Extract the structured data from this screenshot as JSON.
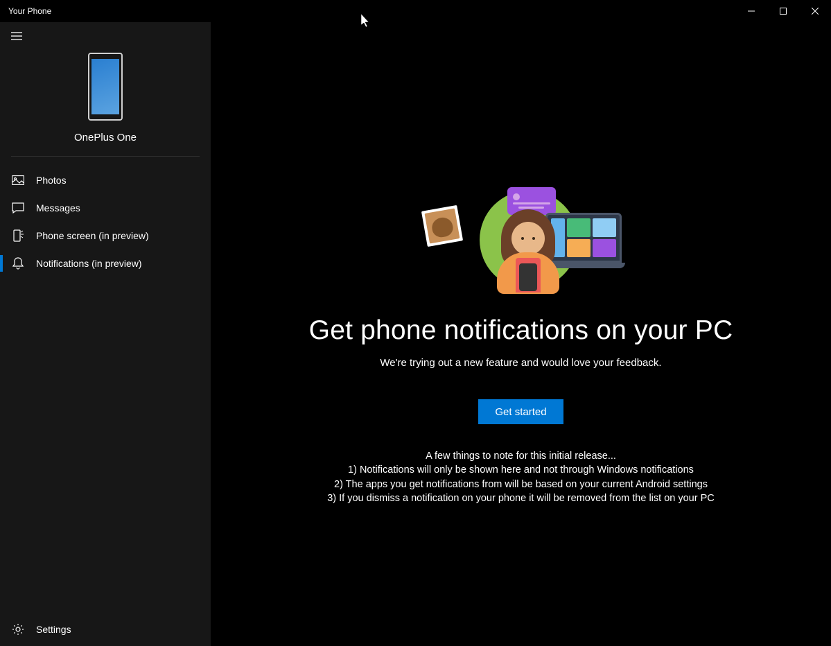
{
  "titlebar": {
    "app_title": "Your Phone"
  },
  "sidebar": {
    "phone_name": "OnePlus One",
    "nav": [
      {
        "label": "Photos"
      },
      {
        "label": "Messages"
      },
      {
        "label": "Phone screen (in preview)"
      },
      {
        "label": "Notifications (in preview)"
      }
    ],
    "settings_label": "Settings"
  },
  "main": {
    "heading": "Get phone notifications on your PC",
    "subheading": "We're trying out a new feature and would love your feedback.",
    "cta_label": "Get started",
    "notes_intro": "A few things to note for this initial release...",
    "notes": [
      "1) Notifications will only be shown here and not through Windows notifications",
      "2) The apps you get notifications from will be based on your current Android settings",
      "3) If you dismiss a notification on your phone it will be removed from the list on your PC"
    ]
  }
}
